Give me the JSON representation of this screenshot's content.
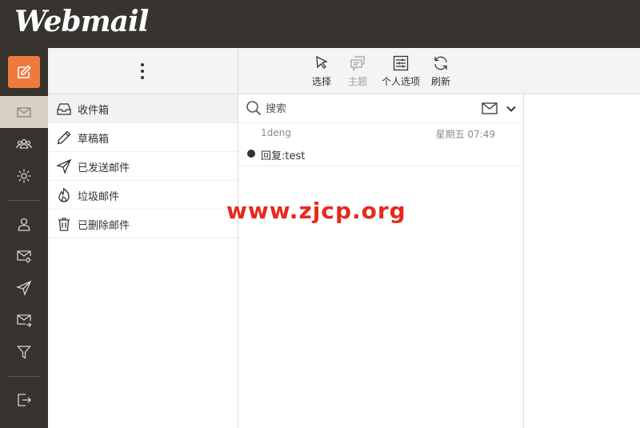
{
  "app": {
    "logo_text": "Webmail"
  },
  "nav": {
    "compose_icon": "compose-icon",
    "items": [
      {
        "name": "mail-icon",
        "active": true
      },
      {
        "name": "contacts-icon",
        "active": false
      },
      {
        "name": "settings-icon",
        "active": false
      },
      {
        "name": "user-icon",
        "active": false
      },
      {
        "name": "mail-settings-icon",
        "active": false
      },
      {
        "name": "send-icon",
        "active": false
      },
      {
        "name": "mail-forward-icon",
        "active": false
      },
      {
        "name": "filter-icon",
        "active": false
      },
      {
        "name": "logout-icon",
        "active": false
      }
    ],
    "accent_color": "#f0793d"
  },
  "folders": {
    "items": [
      {
        "label": "收件箱",
        "icon": "inbox-icon",
        "active": true
      },
      {
        "label": "草稿箱",
        "icon": "pencil-icon",
        "active": false
      },
      {
        "label": "已发送邮件",
        "icon": "send-icon",
        "active": false
      },
      {
        "label": "垃圾邮件",
        "icon": "flame-icon",
        "active": false
      },
      {
        "label": "已删除邮件",
        "icon": "trash-icon",
        "active": false
      }
    ]
  },
  "toolbar": {
    "select_label": "选择",
    "threads_label": "主题",
    "options_label": "个人选项",
    "refresh_label": "刷新"
  },
  "search": {
    "placeholder": "搜索"
  },
  "messages": [
    {
      "from": "1deng",
      "date": "星期五 07:49",
      "subject": "回复:test",
      "unread": true
    }
  ],
  "watermark": {
    "text": "www.zjcp.org",
    "color": "#e8281e"
  }
}
